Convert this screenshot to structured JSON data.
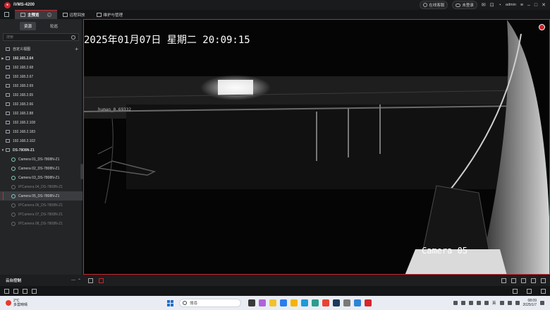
{
  "app": {
    "title": "iVMS-4200",
    "status_online": "在线客服",
    "status_login": "未登录",
    "user": "admin"
  },
  "tabs": [
    {
      "label": "主预览",
      "active": true
    },
    {
      "label": "远程回放",
      "active": false
    },
    {
      "label": "维护与管理",
      "active": false
    }
  ],
  "left_panel": {
    "tab_resources": "资源",
    "tab_patrol": "轮巡",
    "search_placeholder": "搜索",
    "custom_view": "自定义视图",
    "nodes": [
      {
        "label": "192.165.2.64",
        "type": "device",
        "expanded": false,
        "bold": true
      },
      {
        "label": "192.168.2.68",
        "type": "device"
      },
      {
        "label": "192.168.2.67",
        "type": "device"
      },
      {
        "label": "192.168.2.69",
        "type": "device"
      },
      {
        "label": "192.168.2.65",
        "type": "device"
      },
      {
        "label": "192.168.2.66",
        "type": "device"
      },
      {
        "label": "192.168.2.88",
        "type": "device"
      },
      {
        "label": "192.168.2.108",
        "type": "device"
      },
      {
        "label": "192.168.2.183",
        "type": "device"
      },
      {
        "label": "192.168.2.102",
        "type": "device"
      },
      {
        "label": "DS-7808N-Z1",
        "type": "nvr",
        "expanded": true,
        "bold": true
      },
      {
        "label": "Camera 01_DS-7808N-Z1",
        "type": "camera"
      },
      {
        "label": "Camera 02_DS-7808N-Z1",
        "type": "camera"
      },
      {
        "label": "Camera 03_DS-7808N-Z1",
        "type": "camera"
      },
      {
        "label": "IPCamera 04_DS-7808N-Z1",
        "type": "camera",
        "dim": true
      },
      {
        "label": "Camera 05_DS-7808N-Z1",
        "type": "camera",
        "selected": true
      },
      {
        "label": "IPCamera 06_DS-7808N-Z1",
        "type": "camera",
        "dim": true
      },
      {
        "label": "IPCamera 07_DS-7808N-Z1",
        "type": "camera",
        "dim": true
      },
      {
        "label": "IPCamera 08_DS-7808N-Z1",
        "type": "camera",
        "dim": true
      }
    ]
  },
  "video": {
    "timestamp": "2025年01月07日 星期二 20:09:15",
    "camera_name": "Camera 05",
    "detection_label": "human_0.69332"
  },
  "control_bar": {
    "ptz_label": "云台控制"
  },
  "taskbar": {
    "temperature": "2°C",
    "weather": "多雲時晴",
    "search_placeholder": "搜尋",
    "lang": "英",
    "time": "08:09",
    "date": "2025/1/7"
  },
  "colors": {
    "accent": "#d7262c",
    "panel": "#242527",
    "video_bg": "#050505"
  }
}
